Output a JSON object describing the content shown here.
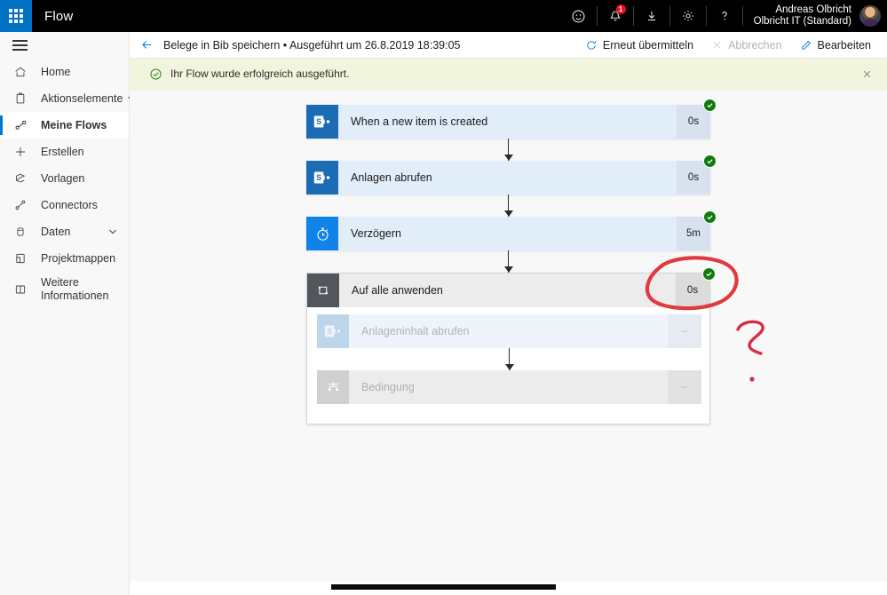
{
  "suite": {
    "app_launcher": "app-launcher",
    "title": "Flow",
    "icons": [
      {
        "name": "feedback-smiley-icon",
        "glyph": "smiley"
      },
      {
        "name": "notifications-bell-icon",
        "glyph": "bell",
        "badge": "1"
      },
      {
        "name": "download-icon",
        "glyph": "download"
      },
      {
        "name": "settings-gear-icon",
        "glyph": "gear"
      },
      {
        "name": "help-question-icon",
        "glyph": "question"
      }
    ],
    "user": {
      "name": "Andreas Olbricht",
      "tenant": "Olbricht IT (Standard)"
    }
  },
  "sidebar": {
    "items": [
      {
        "label": "Home",
        "icon": "home-icon",
        "chevron": false,
        "selected": false
      },
      {
        "label": "Aktionselemente",
        "icon": "clipboard-icon",
        "chevron": true,
        "selected": false
      },
      {
        "label": "Meine Flows",
        "icon": "flow-icon",
        "chevron": false,
        "selected": true
      },
      {
        "label": "Erstellen",
        "icon": "plus-icon",
        "chevron": false,
        "selected": false
      },
      {
        "label": "Vorlagen",
        "icon": "templates-icon",
        "chevron": false,
        "selected": false
      },
      {
        "label": "Connectors",
        "icon": "connectors-icon",
        "chevron": false,
        "selected": false
      },
      {
        "label": "Daten",
        "icon": "database-icon",
        "chevron": true,
        "selected": false
      },
      {
        "label": "Projektmappen",
        "icon": "solutions-icon",
        "chevron": false,
        "selected": false
      },
      {
        "label": "Weitere Informationen",
        "icon": "book-icon",
        "chevron": false,
        "selected": false
      }
    ]
  },
  "commandbar": {
    "back": "back-arrow",
    "run_title": "Belege in Bib speichern • Ausgeführt um 26.8.2019 18:39:05",
    "actions": [
      {
        "label": "Erneut übermitteln",
        "icon": "resubmit-icon",
        "disabled": false
      },
      {
        "label": "Abbrechen",
        "icon": "cancel-x-icon",
        "disabled": true
      },
      {
        "label": "Bearbeiten",
        "icon": "edit-pencil-icon",
        "disabled": false
      }
    ]
  },
  "banner": {
    "icon": "success-check-icon",
    "text": "Ihr Flow wurde erfolgreich ausgeführt.",
    "close": "close-icon",
    "background": "#f2f5dd",
    "icon_color": "#107c10"
  },
  "flow": {
    "steps": [
      {
        "title": "When a new item is created",
        "duration": "0s",
        "icon": "sharepoint-icon",
        "status": "succeeded",
        "dimmed": false
      },
      {
        "title": "Anlagen abrufen",
        "duration": "0s",
        "icon": "sharepoint-icon",
        "status": "succeeded",
        "dimmed": false
      },
      {
        "title": "Verzögern",
        "duration": "5m",
        "icon": "stopwatch-icon",
        "status": "succeeded",
        "dimmed": false
      }
    ],
    "scope": {
      "title": "Auf alle anwenden",
      "duration": "0s",
      "icon": "loop-icon",
      "status": "succeeded",
      "children": [
        {
          "title": "Anlageninhalt abrufen",
          "duration": "–",
          "icon": "sharepoint-icon",
          "dimmed": true
        },
        {
          "title": "Bedingung",
          "duration": "–",
          "icon": "condition-icon",
          "dimmed": true
        }
      ]
    }
  },
  "annotations": {
    "ellipse": {
      "name": "red-ellipse-highlight",
      "color": "#e03a3e"
    },
    "question_mark": {
      "name": "red-question-mark",
      "color": "#d72c45"
    }
  },
  "scrollbar": {
    "name": "horizontal-scrollbar"
  },
  "colors": {
    "accent": "#0078d4",
    "success": "#107c10",
    "suite_bar": "#000000",
    "card_blue": "#e1edf9",
    "sharepoint_blue": "#1b6cb5"
  }
}
